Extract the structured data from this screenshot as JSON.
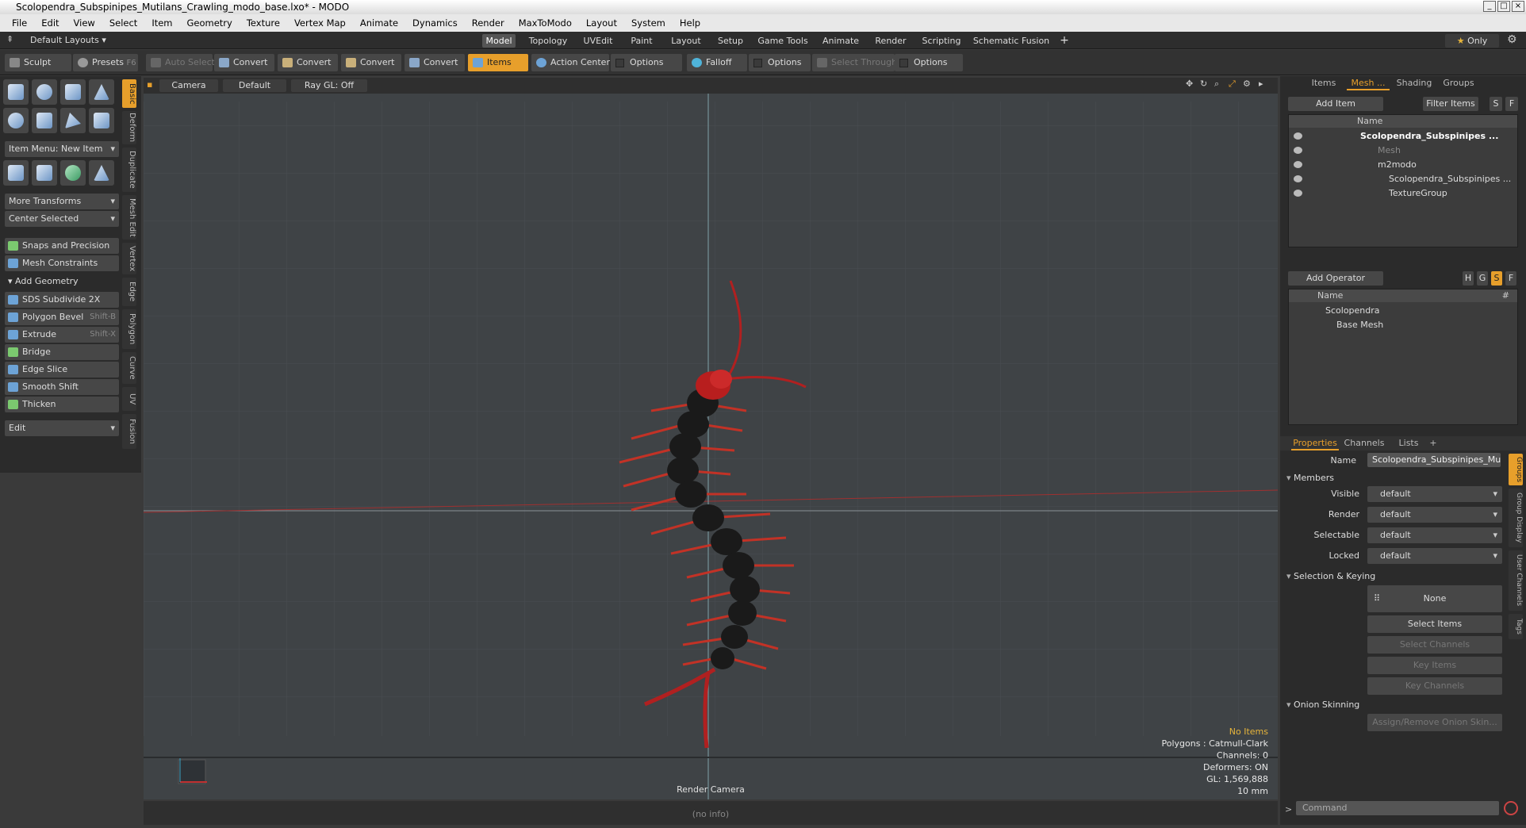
{
  "window": {
    "title": "Scolopendra_Subspinipes_Mutilans_Crawling_modo_base.lxo* - MODO"
  },
  "menu": [
    "File",
    "Edit",
    "View",
    "Select",
    "Item",
    "Geometry",
    "Texture",
    "Vertex Map",
    "Animate",
    "Dynamics",
    "Render",
    "MaxToModo",
    "Layout",
    "System",
    "Help"
  ],
  "layout": {
    "preset": "Default Layouts",
    "tabs": [
      "Model",
      "Topology",
      "UVEdit",
      "Paint",
      "Layout",
      "Setup",
      "Game Tools",
      "Animate",
      "Render",
      "Scripting",
      "Schematic Fusion"
    ],
    "add": "+",
    "only": "Only"
  },
  "toolbar": {
    "sculpt": "Sculpt",
    "presets": "Presets",
    "presets_key": "F6",
    "auto_select": "Auto Select",
    "convert1": "Convert",
    "convert2": "Convert",
    "convert3": "Convert",
    "convert4": "Convert",
    "items": "Items",
    "action_center": "Action Center",
    "options1": "Options",
    "falloff": "Falloff",
    "options2": "Options",
    "select_through": "Select Through",
    "options3": "Options"
  },
  "left": {
    "item_menu": "Item Menu: New Item",
    "more_transforms": "More Transforms",
    "center_selected": "Center Selected",
    "snaps": "Snaps and Precision",
    "mesh_constraints": "Mesh Constraints",
    "add_geometry": "Add Geometry",
    "tools": [
      {
        "label": "SDS Subdivide 2X",
        "key": ""
      },
      {
        "label": "Polygon Bevel",
        "key": "Shift-B"
      },
      {
        "label": "Extrude",
        "key": "Shift-X"
      },
      {
        "label": "Bridge",
        "key": ""
      },
      {
        "label": "Edge Slice",
        "key": ""
      },
      {
        "label": "Smooth Shift",
        "key": ""
      },
      {
        "label": "Thicken",
        "key": ""
      }
    ],
    "edit": "Edit",
    "vtabs": [
      "Basic",
      "Deform",
      "Duplicate",
      "Mesh Edit",
      "Vertex",
      "Edge",
      "Polygon",
      "Curve",
      "UV",
      "Fusion"
    ]
  },
  "viewport": {
    "camera": "Camera",
    "default": "Default",
    "raygl": "Ray GL: Off",
    "render_camera": "Render Camera",
    "info": [
      "No Items",
      "Polygons : Catmull-Clark",
      "Channels: 0",
      "Deformers: ON",
      "GL: 1,569,888",
      "10 mm"
    ],
    "status": "(no info)"
  },
  "right": {
    "tabs": [
      "Items",
      "Mesh ...",
      "Shading",
      "Groups"
    ],
    "add_item": "Add Item",
    "filter_items": "Filter Items",
    "s": "S",
    "f": "F",
    "name_col": "Name",
    "tree": [
      "Scolopendra_Subspinipes ...",
      "Mesh",
      "m2modo",
      "Scolopendra_Subspinipes ...",
      "TextureGroup"
    ],
    "add_operator": "Add Operator",
    "h": "H",
    "g": "G",
    "s2": "S",
    "f2": "F",
    "op_name": "Name",
    "op_hash": "#",
    "ops": [
      "Scolopendra",
      "Base Mesh"
    ],
    "prop_tabs": [
      "Properties",
      "Channels",
      "Lists",
      "+"
    ],
    "name_label": "Name",
    "name_value": "Scolopendra_Subspinipes_Mutilar",
    "members": "Members",
    "visible": "Visible",
    "render": "Render",
    "selectable": "Selectable",
    "locked": "Locked",
    "default": "default",
    "selection_keying": "Selection & Keying",
    "none": "None",
    "select_items": "Select Items",
    "select_channels": "Select Channels",
    "key_items": "Key Items",
    "key_channels": "Key Channels",
    "onion": "Onion Skinning",
    "assign_onion": "Assign/Remove Onion Skin...",
    "side_tabs": [
      "Groups",
      "Group Display",
      "User Channels",
      "Tags"
    ],
    "command": "Command"
  }
}
